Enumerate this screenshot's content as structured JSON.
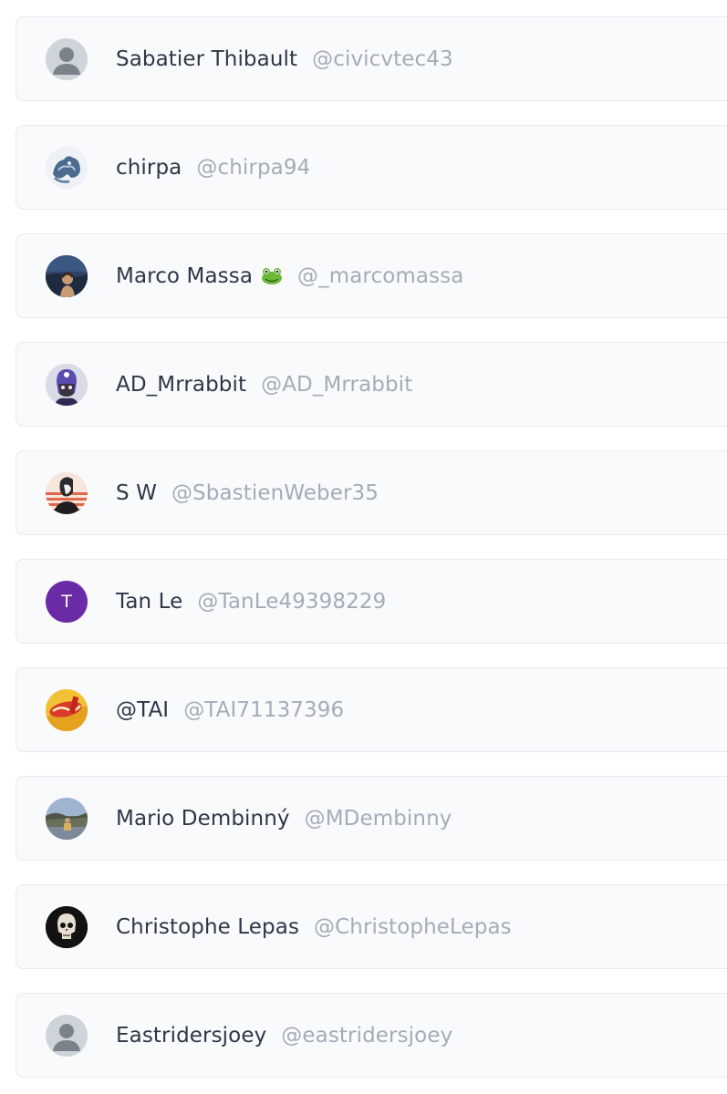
{
  "users": [
    {
      "name": "Sabatier Thibault",
      "handle": "@civicvtec43",
      "avatar": "default-user-icon"
    },
    {
      "name": "chirpa",
      "handle": "@chirpa94",
      "avatar": "photo-avatar"
    },
    {
      "name": "Marco Massa",
      "emoji": "frog-emoji",
      "handle": "@_marcomassa",
      "avatar": "photo-avatar"
    },
    {
      "name": "AD_Mrrabbit",
      "handle": "@AD_Mrrabbit",
      "avatar": "photo-avatar"
    },
    {
      "name": "S W",
      "handle": "@SbastienWeber35",
      "avatar": "photo-avatar"
    },
    {
      "name": "Tan Le",
      "handle": "@TanLe49398229",
      "avatar": "letter-avatar",
      "avatar_letter": "T",
      "avatar_color": "#6b2aa6"
    },
    {
      "name": "@TAI",
      "handle": "@TAI71137396",
      "avatar": "photo-avatar"
    },
    {
      "name": "Mario Dembinný",
      "handle": "@MDembinny",
      "avatar": "photo-avatar"
    },
    {
      "name": "Christophe Lepas",
      "handle": "@ChristopheLepas",
      "avatar": "photo-avatar"
    },
    {
      "name": "Eastridersjoey",
      "handle": "@eastridersjoey",
      "avatar": "default-user-icon"
    }
  ],
  "colors": {
    "card_background": "#f9fafb",
    "card_border": "#e7eaee",
    "name_text": "#2d3748",
    "handle_text": "#a3acb9"
  }
}
